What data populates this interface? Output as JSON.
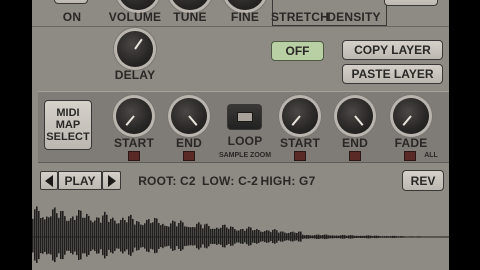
{
  "top_row": {
    "on_label": "ON",
    "volume_label": "VOLUME",
    "tune_label": "TUNE",
    "fine_label": "FINE",
    "stretch_label": "STRETCH",
    "density_label": "DENSITY"
  },
  "delay": {
    "label": "DELAY"
  },
  "buttons": {
    "off_label": "OFF",
    "copy_layer_label": "COPY LAYER",
    "paste_layer_label": "PASTE LAYER"
  },
  "sample_section": {
    "midi_map_line1": "MIDI",
    "midi_map_line2": "MAP",
    "midi_map_line3": "SELECT",
    "start_label": "START",
    "end_label": "END",
    "loop_label": "LOOP",
    "sample_zoom_label": "SAMPLE ZOOM",
    "loop_start_label": "START",
    "loop_end_label": "END",
    "fade_label": "FADE",
    "all_label": "ALL"
  },
  "transport": {
    "prev_icon": "triangle-left-icon",
    "play_label": "PLAY",
    "next_icon": "triangle-right-icon",
    "root_label": "ROOT: C2",
    "low_label": "LOW: C-2",
    "high_label": "HIGH: G7",
    "rev_label": "REV"
  },
  "colors": {
    "panel": "#8e8a84",
    "off_button_fill": "#b9d0a4",
    "led": "#5a2a26"
  }
}
